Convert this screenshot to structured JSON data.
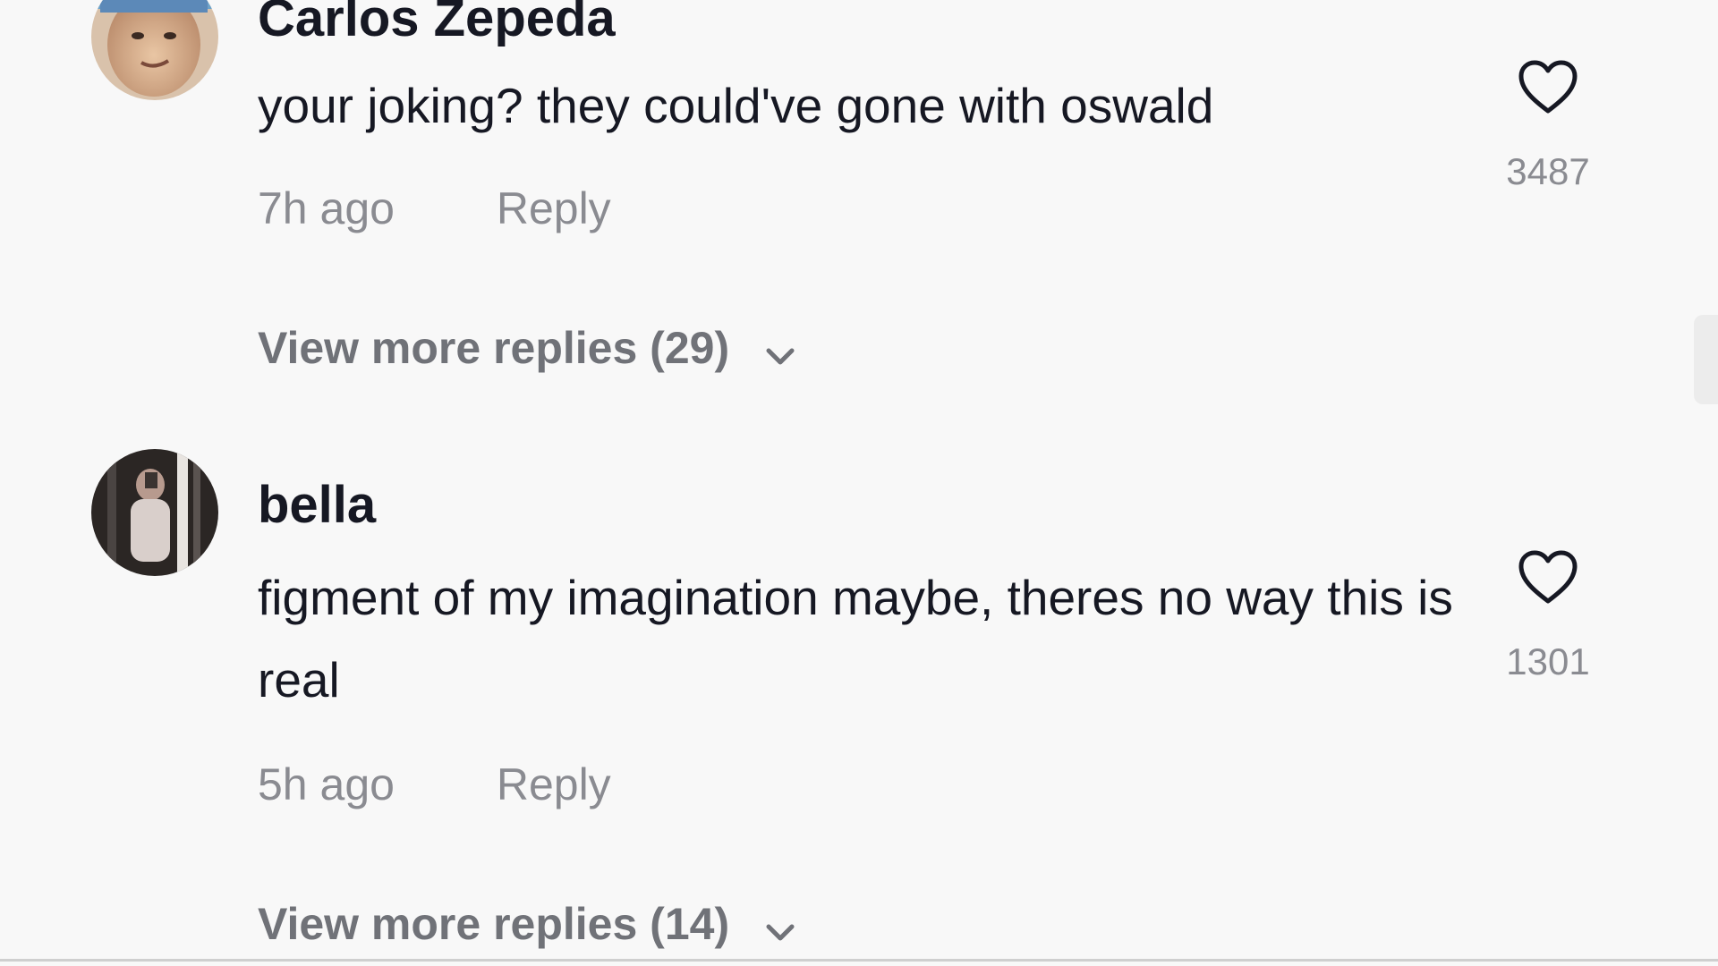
{
  "comments": [
    {
      "username": "Carlos Zepeda",
      "text": "your joking? they could've gone with oswald",
      "time": "7h ago",
      "reply_label": "Reply",
      "likes": "3487",
      "view_more": "View more replies (29)",
      "avatar_icon": "user-avatar-photo"
    },
    {
      "username": "bella",
      "text": "figment of my imagination maybe, theres no way this is real",
      "time": "5h ago",
      "reply_label": "Reply",
      "likes": "1301",
      "view_more": "View more replies (14)",
      "avatar_icon": "user-avatar-photo"
    }
  ],
  "icons": {
    "like": "heart-outline-icon",
    "expand": "chevron-down-icon"
  },
  "colors": {
    "background": "#f8f8f8",
    "primary_text": "#161823",
    "secondary_text": "#8a8b91",
    "view_more_text": "#707278"
  }
}
